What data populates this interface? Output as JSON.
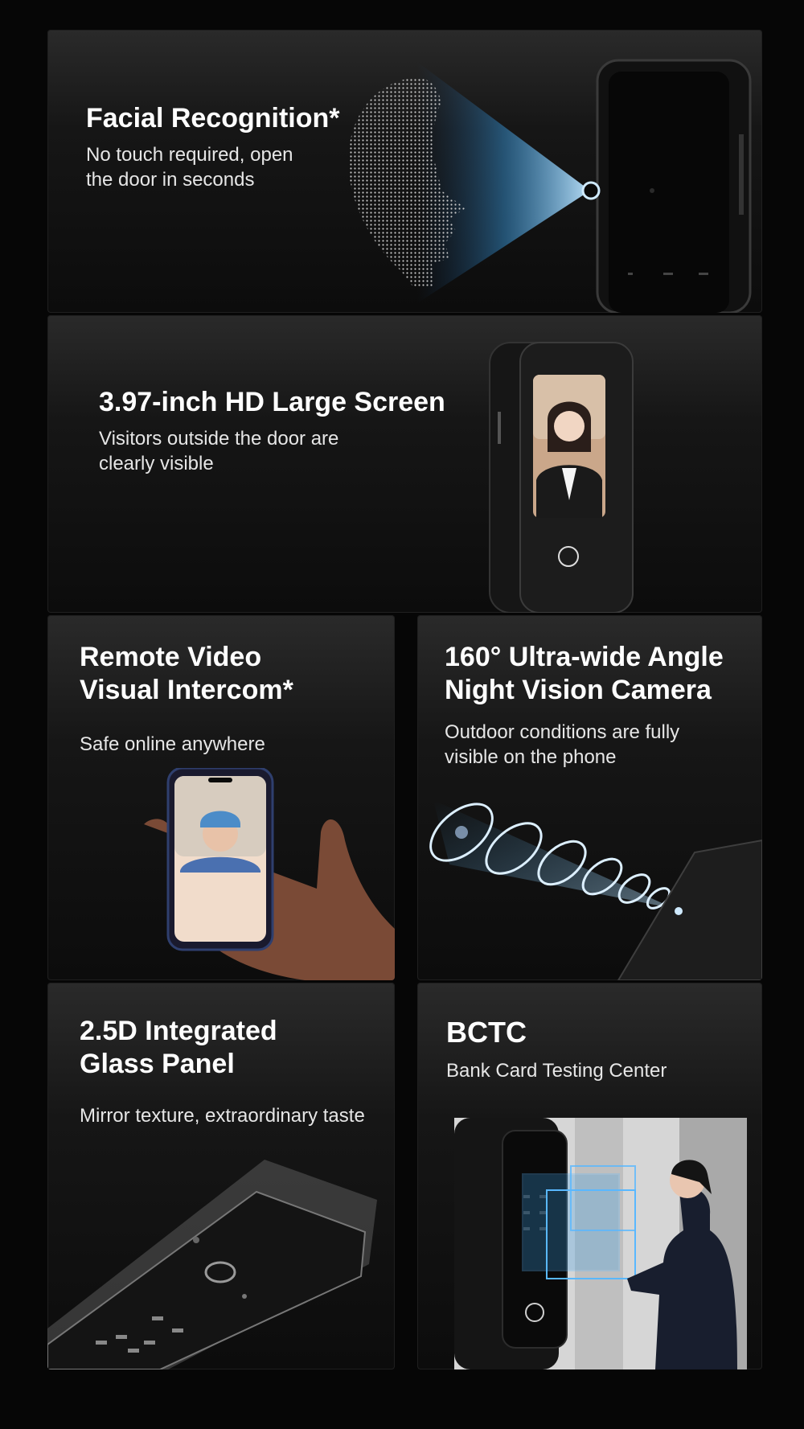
{
  "cards": [
    {
      "title": [
        "Facial Recognition*"
      ],
      "subtitle": [
        "No touch required, open",
        "the door in seconds"
      ]
    },
    {
      "title": [
        "3.97-inch HD Large Screen"
      ],
      "subtitle": [
        "Visitors outside the door are",
        "clearly visible"
      ]
    },
    {
      "title": [
        "Remote Video",
        "Visual Intercom*"
      ],
      "subtitle": [
        "Safe online anywhere"
      ]
    },
    {
      "title": [
        "160° Ultra-wide Angle",
        "Night Vision Camera"
      ],
      "subtitle": [
        "Outdoor conditions are fully",
        "visible on the phone"
      ]
    },
    {
      "title": [
        "2.5D Integrated",
        "Glass Panel"
      ],
      "subtitle": [
        "Mirror texture, extraordinary taste"
      ]
    },
    {
      "title": [
        "BCTC"
      ],
      "subtitle": [
        "Bank Card Testing Center"
      ]
    }
  ],
  "icons": [
    "face-scan-icon",
    "camera-beam-icon",
    "fingerprint-icon",
    "phone-icon",
    "camera-lens-icon"
  ],
  "colors": {
    "background": "#060606",
    "accent_blue": "#3aa0e8",
    "text": "#ffffff"
  }
}
